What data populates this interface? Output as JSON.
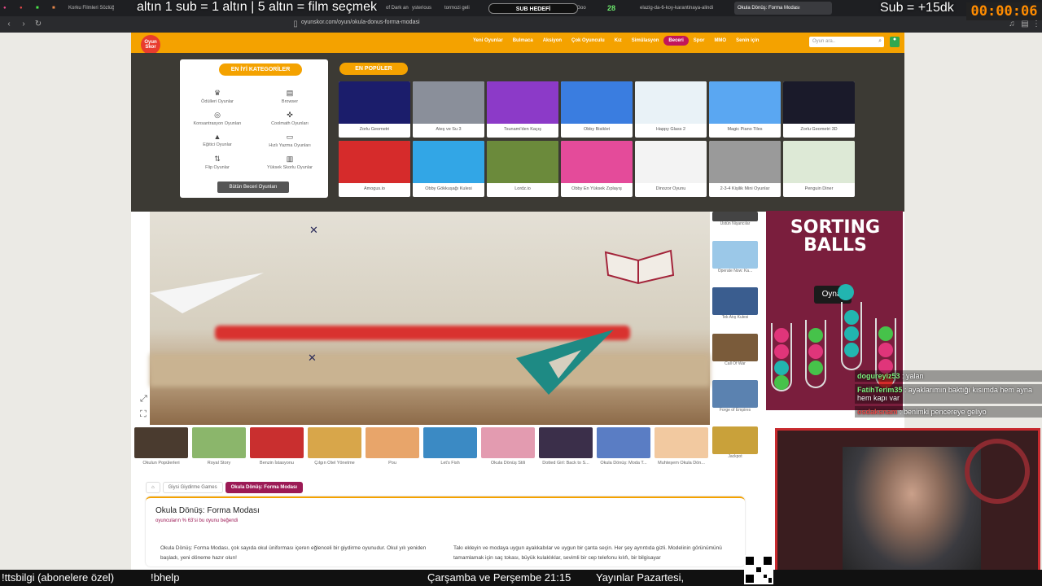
{
  "browser": {
    "tabs": [
      {
        "label": "Korku Filmleri Sözlüğü"
      },
      {
        "label": "of Dark and"
      },
      {
        "label": "ysterious"
      },
      {
        "label": "tormozi geli"
      },
      {
        "label": "elazığ köy - Goo"
      },
      {
        "label": "elazig-da-6-koy-karantinaya-alindi"
      },
      {
        "label": "Okula Dönüş: Forma Modası"
      }
    ],
    "url": "oyunskor.com/oyun/okula-donus-forma-modasi",
    "badge_count": "28"
  },
  "stream": {
    "top_text": "altın   1 sub = 1 altın | 5 altın = film seçmek",
    "sub_goal": "SUB HEDEFİ",
    "sub_bonus": "Sub = +15dk",
    "timer": "00:00:06",
    "bottom_left": "!ttsbilgi (abonelere özel)",
    "bottom_help": "!bhelp",
    "bottom_schedule": "Çarşamba ve Perşembe 21:15",
    "bottom_right": "Yayınlar Pazartesi,"
  },
  "chat": [
    {
      "user": "dogureyiz53",
      "text": ": yalan"
    },
    {
      "user": "FatihTerim35",
      "text": ": ayaklarımın baktığı kısımda hem ayna hem kapı var"
    },
    {
      "user": "osdaksnam",
      "text": ": benimki pencereye geliyo"
    }
  ],
  "site": {
    "logo": "Oyun Skor",
    "menu": [
      "Yeni Oyunlar",
      "Bulmaca",
      "Aksiyon",
      "Çok Oyunculu",
      "Kız",
      "Simülasyon",
      "Beceri",
      "Spor",
      "MMO",
      "Senin için"
    ],
    "active_menu": "Beceri",
    "search_placeholder": "Oyun ara.."
  },
  "dropdown": {
    "categories_title": "EN İYİ KATEGORİLER",
    "categories": [
      {
        "label": "Ödülleri Oyunlar",
        "icon": "trophy-icon"
      },
      {
        "label": "Browser",
        "icon": "browser-icon"
      },
      {
        "label": "Konsantrasyon Oyunları",
        "icon": "target-icon"
      },
      {
        "label": "Coolmath Oyunları",
        "icon": "gamepad-icon"
      },
      {
        "label": "Eğitici Oyunlar",
        "icon": "graduation-icon"
      },
      {
        "label": "Hızlı Yazma Oyunları",
        "icon": "keyboard-icon"
      },
      {
        "label": "Flip Oyunlar",
        "icon": "flip-icon"
      },
      {
        "label": "Yüksek Skorlu Oyunlar",
        "icon": "podium-icon"
      }
    ],
    "all_button": "Bütün Beceri Oyunları",
    "popular_title": "EN POPÜLER",
    "popular": [
      {
        "label": "Zorlu Geometri",
        "color": "#1b1d6b"
      },
      {
        "label": "Ateş ve Su 3",
        "color": "#8a8f9a"
      },
      {
        "label": "Tsunami'den Kaçış",
        "color": "#8c3ac8"
      },
      {
        "label": "Obby Bisiklet",
        "color": "#3a7de0"
      },
      {
        "label": "Happy Glass 2",
        "color": "#e9f2f7"
      },
      {
        "label": "Magic Piano Tiles",
        "color": "#5aa7f2"
      },
      {
        "label": "Zorlu Geometri 3D",
        "color": "#1a1a2a"
      },
      {
        "label": "Amogus.io",
        "color": "#d62b2b"
      },
      {
        "label": "Obby Gökkuşağı Kulesi",
        "color": "#32a6e6"
      },
      {
        "label": "Lordz.io",
        "color": "#6b8a3b"
      },
      {
        "label": "Obby En Yüksek Zıplayış",
        "color": "#e44b9a"
      },
      {
        "label": "Dinozor Oyunu",
        "color": "#f3f3f3"
      },
      {
        "label": "2-3-4 Kişilik Mini Oyunlar",
        "color": "#9a9a9a"
      },
      {
        "label": "Penguin Diner",
        "color": "#dde9d6"
      }
    ]
  },
  "side_games": [
    {
      "label": "Üstün Nişancılar",
      "color": "#444"
    },
    {
      "label": "Operate Now: Ka...",
      "color": "#9bc8e8"
    },
    {
      "label": "Tek Atış Kulesi",
      "color": "#3a5d8f"
    },
    {
      "label": "Call Of War",
      "color": "#7a5b3a"
    },
    {
      "label": "Forge of Empires",
      "color": "#5b82b0"
    },
    {
      "label": "Jackpot",
      "color": "#c9a13a"
    }
  ],
  "ad": {
    "title": "SORTING BALLS",
    "play": "Oyna!"
  },
  "row_games": [
    {
      "label": "Okulun Popülerleri",
      "color": "#4a3b2f"
    },
    {
      "label": "Royal Story",
      "color": "#8bb66b"
    },
    {
      "label": "Benzin İstasyonu",
      "color": "#c92f2f"
    },
    {
      "label": "Çılgın Otel Yönetme",
      "color": "#d8a64a"
    },
    {
      "label": "Pou",
      "color": "#e8a56a"
    },
    {
      "label": "Let's Fish",
      "color": "#3b8ac4"
    },
    {
      "label": "Okula Dönüş Stili",
      "color": "#e39bb0"
    },
    {
      "label": "Dotted Girl: Back to S...",
      "color": "#3b2f4a"
    },
    {
      "label": "Okula Dönüş: Moda T...",
      "color": "#5a7dc4"
    },
    {
      "label": "Muhteşem Okula Dön...",
      "color": "#f2c9a0"
    }
  ],
  "breadcrumb": {
    "home": "⌂",
    "category": "Giysi Giydirme Games",
    "current": "Okula Dönüş: Forma Modası"
  },
  "info": {
    "title": "Okula Dönüş: Forma Modası",
    "rating": "oyuncuların % 63'si bu oyunu beğendi",
    "desc_left": "Okula Dönüş: Forma Modası, çok sayıda okul üniforması içeren eğlenceli bir giydirme oyunudur. Okul yılı yeniden başladı, yeni döneme hazır olun!",
    "desc_right": "Takı ekleyin ve modaya uygun ayakkabılar ve uygun bir çanta seçin. Her şey ayrıntıda gizli. Modelinin görünümünü tamamlamak için saç tokası, büyük kulaklıklar, sevimli bir cep telefonu kılıfı, bir bilgisayar"
  }
}
